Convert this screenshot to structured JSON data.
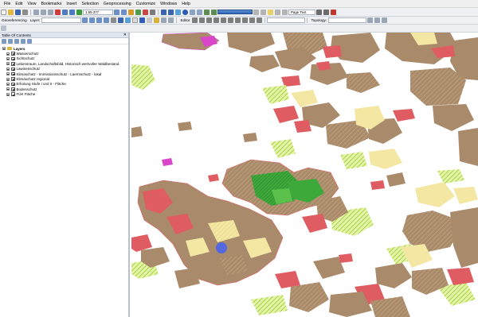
{
  "menu": [
    "File",
    "Edit",
    "View",
    "Bookmarks",
    "Insert",
    "Selection",
    "Geoprocessing",
    "Customize",
    "Windows",
    "Help"
  ],
  "toolbar": {
    "scale": "1:69.377",
    "page_text": "Page Text"
  },
  "toolbar2": {
    "georeferencing": "Georeferencing",
    "layer": "Layer:",
    "editor": "Editor",
    "topology": "Topology:"
  },
  "toc": {
    "title": "Table Of Contents",
    "close": "✕",
    "root": "Layers",
    "layers": [
      "Wasserschutz",
      "Sichtschutz",
      "Lebensraum, Landschaftsbild, Historisch wertvoller Waldbestand",
      "Lawinenschutz",
      "Klimaschutz - Immissionsschutz - Laermschutz - lokal",
      "Klimaschutz regional",
      "Erholung Stufe I und II - Fläche",
      "Bodenschutz",
      "FÜK Fläche"
    ]
  },
  "colors": {
    "brown": "#a98a6a",
    "red": "#e05c63",
    "yellow": "#f3e7a3",
    "green": "#3da93a",
    "lime": "#b8e24a",
    "blue": "#5468e0",
    "magenta": "#d946c9"
  }
}
